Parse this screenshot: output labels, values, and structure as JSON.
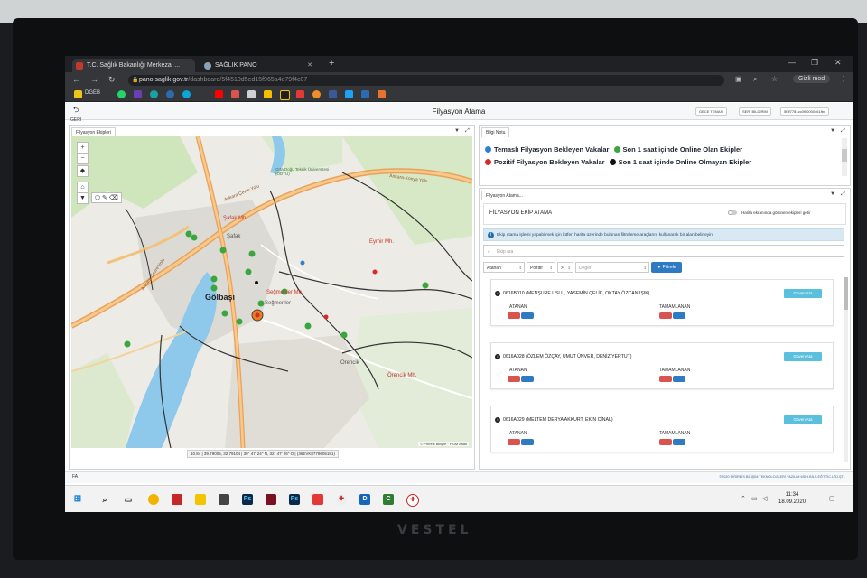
{
  "browser": {
    "tabs": [
      {
        "label": "T.C. Sağlık Bakanlığı Merkezal ..."
      },
      {
        "label": "SAĞLIK PANO"
      }
    ],
    "url_host": "pano.saglik.gov.tr",
    "url_path": "/dashboard/5f4510d5ed15f965a4e79f4c07",
    "profile_label": "Gizli mod",
    "bookmark_first": "DGEB"
  },
  "app": {
    "back_label": "GERİ",
    "title": "Filyasyon Atama",
    "header_buttons": [
      "GECE TEMASI",
      "SERİ BİLDİRİM",
      "5f3f7781cc0f00000461fbd"
    ]
  },
  "map_panel": {
    "tab_label": "Filyasyon Ekipleri",
    "labels": {
      "golbasi": "Gölbaşı",
      "safak": "Şafak Mh.",
      "safak2": "Şafak",
      "eymir": "Eymir Mh.",
      "seglim": "Seğmenler Mh.",
      "seglim2": "Seğmenler",
      "orencik": "Örencik Mh.",
      "orencik2": "Örencik",
      "odtu": "Orta Doğu Teknik Üniversitesi (ODTÜ)",
      "road1": "Ankara Çevre Yolu",
      "road2": "Ankara Çevre Yolu",
      "road3": "Ankara-Konya Yolu"
    },
    "attribution": "© Pirireis Bilişim · HGM Atlas",
    "coords": "10.84 | 39.79005, 32.79104 | 39° 47' 24'' N, 32° 47' 26'' O | (36EVK8779605181)"
  },
  "bilgi_panel": {
    "tab_label": "Bilgi Notu",
    "legend": [
      {
        "text": "Temaslı Filyasyon Bekleyen Vakalar",
        "color": "#2f7fd0"
      },
      {
        "text": "Son 1 saat içinde Online Olan Ekipler",
        "color": "#3aa640"
      },
      {
        "text": "Pozitif Filyasyon Bekleyen Vakalar",
        "color": "#d52b2b"
      },
      {
        "text": "Son 1 saat içinde Online Olmayan Ekipler",
        "color": "#111111"
      }
    ]
  },
  "filyasyon_panel": {
    "tab_label": "Filyasyon Atama...",
    "header_title": "FİLYASYON EKİP ATAMA",
    "toggle_label": "Harita ekranında görünen ekipleri getir",
    "info_text": "Ekip atama işlemi yapabilmek için lütfen harita üzerinde bulunan  filtreleme araçlarını kullanarak bir alan belirleyin.",
    "search_placeholder": "Ekip ara",
    "filters": {
      "f1": "Atanan",
      "f2": "Pozitif",
      "f3": ">",
      "f4": "Değer",
      "button": "Filtrele"
    },
    "teams": [
      {
        "code": "0616B010",
        "members": "(MENŞURE USLU, YASEMİN ÇELİK, OKTAY ÖZCAN IŞIK)",
        "atanan": "ATANAN",
        "tamamlanan": "TAMAMLANAN",
        "button": "Güven Ata"
      },
      {
        "code": "0616A028",
        "members": "(ÖZLEM ÖZÇAY, UMUT ÜNVER, DENİZ YERTUT)",
        "atanan": "ATANAN",
        "tamamlanan": "TAMAMLANAN",
        "button": "Güven Ata"
      },
      {
        "code": "0616A029",
        "members": "(MELTEM DERYA AKKURT, EKİN CİNAL)",
        "atanan": "ATANAN",
        "tamamlanan": "TAMAMLANAN",
        "button": "Güven Ata"
      }
    ]
  },
  "footer": {
    "left": "FA",
    "copyright": "©2020 PİRİREİS BİLİŞİM TEKNOLOJİLERİ YAZILIM MÜH.BİLS.EĞT.TİC.LTD.ŞTİ."
  },
  "taskbar": {
    "time": "11:34",
    "date": "18.09.2020"
  },
  "monitor_brand": "VESTEL"
}
